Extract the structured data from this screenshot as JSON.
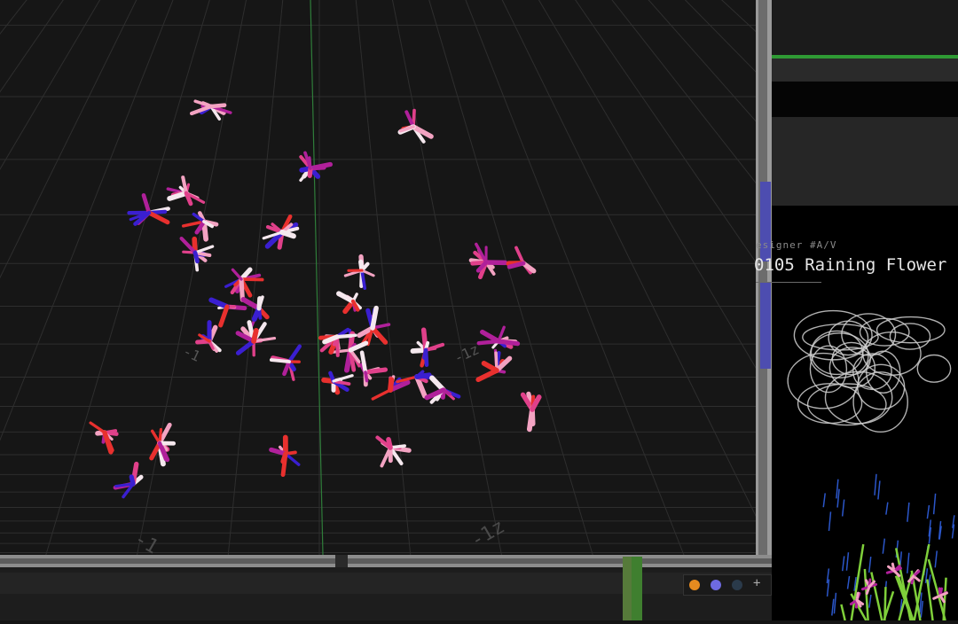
{
  "window": {
    "project_subtitle": "esigner #A/V",
    "project_title": "0105 Raining Flower"
  },
  "viewport": {
    "axis_labels": [
      "-1",
      "-1",
      "-1z",
      "-1z"
    ]
  },
  "dock": {
    "plus_label": "+",
    "dot_colors": [
      "#e58a1f",
      "#6e6ae0",
      "#2a3a4a"
    ]
  },
  "palette": {
    "pink": "#e0408a",
    "light_pink": "#f3a3c2",
    "white": "#f5e8ee",
    "red": "#e8302e",
    "violet": "#3a1fd0",
    "magenta": "#b0209a"
  }
}
